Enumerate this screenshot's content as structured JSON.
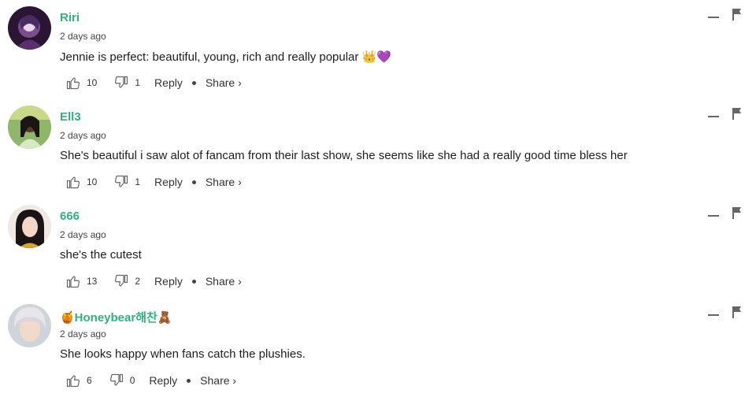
{
  "comments": [
    {
      "username": "Riri",
      "time": "2 days ago",
      "text": "Jennie is perfect: beautiful, young, rich and really popular 👑💜",
      "likes": "10",
      "dislikes": "1",
      "reply_label": "Reply",
      "share_label": "Share ›",
      "avatar_color": "#3b2147"
    },
    {
      "username": "Ell3",
      "time": "2 days ago",
      "text": "She's beautiful i saw alot of fancam from their last show, she seems like she had a really good time bless her",
      "likes": "10",
      "dislikes": "1",
      "reply_label": "Reply",
      "share_label": "Share ›",
      "avatar_color": "#9bbf6f"
    },
    {
      "username": "666",
      "time": "2 days ago",
      "text": "she's the cutest",
      "likes": "13",
      "dislikes": "2",
      "reply_label": "Reply",
      "share_label": "Share ›",
      "avatar_color": "#e8dfd8"
    },
    {
      "username": "🍯Honeybear해찬🧸",
      "time": "2 days ago",
      "text": "She looks happy when fans catch the plushies.",
      "likes": "6",
      "dislikes": "0",
      "reply_label": "Reply",
      "share_label": "Share ›",
      "avatar_color": "#c9ced6"
    }
  ],
  "colors": {
    "username": "#2fb37a",
    "text": "#1d1d1d",
    "icon": "#666666"
  }
}
